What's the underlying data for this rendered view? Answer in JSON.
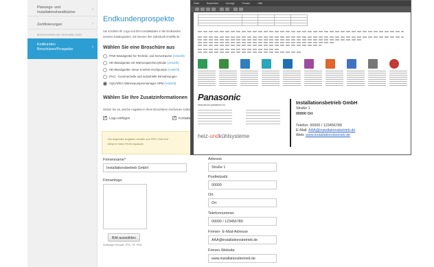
{
  "sidebar": {
    "items": [
      {
        "label_1": "Planungs- und",
        "label_2": "Installationshandbücher"
      },
      {
        "label_1": "Zertifizierungen",
        "label_2": ""
      }
    ],
    "heading": "BROSCHÜREN MIT EIGENEM LOGO",
    "active": {
      "label_1": "Endkunden",
      "label_2": "Broschüren/Prospekte"
    }
  },
  "main": {
    "title": "Endkundenprospekte",
    "intro_1": "Sie möchten Ihr Logo und Ihre Kontaktdaten in die Endkunden",
    "intro_2": "unseren Katalogseiten. Sie können Ihre individuell erstellte Br",
    "section_brochure": "Wählen Sie eine Broschüre aus",
    "radios": [
      {
        "text": "PAW Wandgeräte für Technik- und Serverräume ",
        "link": "(Ansicht)",
        "selected": false
      },
      {
        "text": "HE-Wandgeräte mit Wärmespeicherzylinder ",
        "link": "(Ansicht)",
        "selected": false
      },
      {
        "text": "HE-Wandgeräte: Neue Komfort-Hochpumpe ",
        "link": "(Ansicht)",
        "selected": false
      },
      {
        "text": "PACi - Kommerzielle und industrielle Klimalösungen ",
        "link": "",
        "selected": false
      },
      {
        "text": "AQUAREA Wärmepumpenmanager HPM ",
        "link": "(Ansicht)",
        "selected": true
      }
    ],
    "section_extra": "Wählen Sie Ihre Zusatzinformationen",
    "extra_text": "Geben Sie an, welche Angaben in Ihren Broschüren erscheinen sollen.",
    "checkboxes": [
      {
        "label": "Logo einfügen",
        "checked": true
      },
      {
        "label": "Kontaktdaten",
        "checked": true
      }
    ],
    "notice_1": "Die folgenden Angaben wurden aus PRO Club Ihre",
    "notice_2": "diese in Ihrem Profil anpassen"
  },
  "form_left": {
    "company_label": "Firmenname*",
    "company_value": "Installationsbetrieb GmbH",
    "logo_label": "Firmenlogo",
    "upload_button": "Bild auswählen",
    "formats_hint": "Zulässige Formate: JPG, TIF, PNG"
  },
  "form_right": {
    "address_label": "Adresse",
    "address_value": "Straße 1",
    "zip_label": "Postleitzahl",
    "zip_value": "00000",
    "city_label": "Ort",
    "city_value": "Ort",
    "phone_label": "Telefonnummer",
    "phone_value": "00000 / 123456789",
    "email_label": "Firmen- E-Mail-Adresse",
    "email_value": "AAA@installationsbetrieb.de",
    "website_label": "Firmen-Website",
    "website_value": "www.installationsbetrieb.de"
  },
  "preview": {
    "menu": [
      "Datei",
      "Bearbeiten",
      "Anzeige",
      "Fenster",
      "Hilfe"
    ],
    "brand": "Panasonic",
    "brand_url": "www.aircon.panasonic.eu",
    "tagline_1": "heiz",
    "tagline_2": "-und",
    "tagline_3": "kühlsysteme",
    "card": {
      "title": "Installationsbetrieb GmbH",
      "street": "Straße 1",
      "city": "00000 Ort",
      "phone": "Telefon: 00000 / 123456789",
      "email_prefix": "E-Mail: ",
      "email": "AAA@installationsbetrieb.de",
      "web_prefix": "Web: ",
      "web": "www.installationsbetrieb.de"
    },
    "tile_colors": [
      "#2e9c57",
      "#3a8f3e",
      "#2f7fc1",
      "#2aa7b8",
      "#1f6fb3",
      "#a04a9e",
      "#e0662b",
      "#3f73c2",
      "#777777",
      "#c23b34"
    ]
  }
}
